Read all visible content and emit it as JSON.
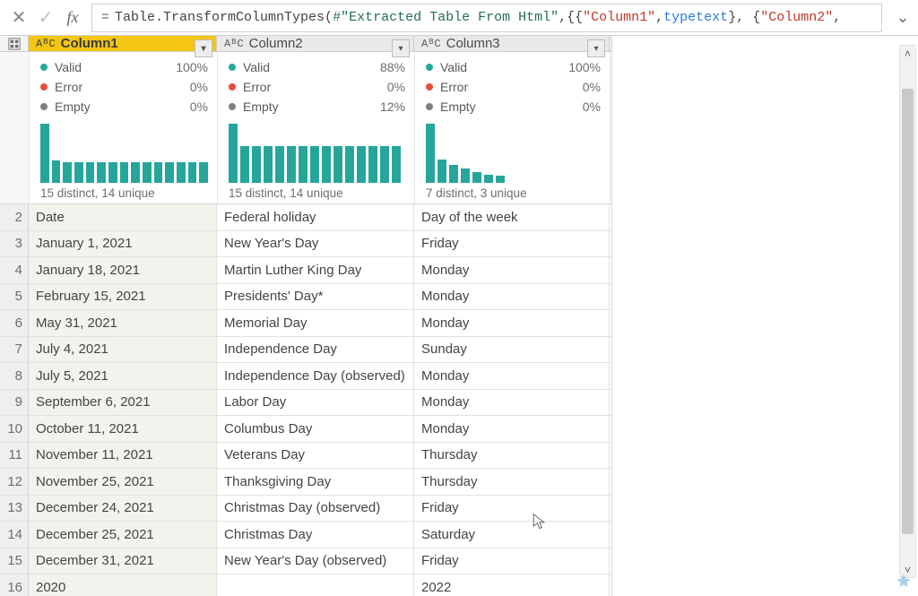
{
  "formula": {
    "equals": "=",
    "prefix": "Table.TransformColumnTypes(",
    "step_ref": "#\"Extracted Table From Html\"",
    "mid": ",{{",
    "str1": "\"Column1\"",
    "mid2": ", ",
    "kw_type1": "type",
    "sp1": " ",
    "kw_text1": "text",
    "mid3": "}, {",
    "str2": "\"Column2\"",
    "mid4": ","
  },
  "columns": [
    {
      "name": "Column1",
      "type_badge": "AᴮC",
      "selected": true,
      "quality": {
        "valid": "100%",
        "error": "0%",
        "empty": "0%",
        "empty_ratio": 0
      },
      "bars": [
        100,
        38,
        35,
        35,
        35,
        35,
        35,
        35,
        35,
        35,
        35,
        35,
        35,
        35,
        35
      ],
      "distinct_text": "15 distinct, 14 unique"
    },
    {
      "name": "Column2",
      "type_badge": "AᴮC",
      "selected": false,
      "quality": {
        "valid": "88%",
        "error": "0%",
        "empty": "12%",
        "empty_ratio": 0.12
      },
      "bars": [
        100,
        62,
        62,
        62,
        62,
        62,
        62,
        62,
        62,
        62,
        62,
        62,
        62,
        62,
        62
      ],
      "distinct_text": "15 distinct, 14 unique"
    },
    {
      "name": "Column3",
      "type_badge": "AᴮC",
      "selected": false,
      "quality": {
        "valid": "100%",
        "error": "0%",
        "empty": "0%",
        "empty_ratio": 0
      },
      "bars": [
        100,
        40,
        30,
        24,
        18,
        14,
        12
      ],
      "distinct_text": "7 distinct, 3 unique"
    }
  ],
  "metric_labels": {
    "valid": "Valid",
    "error": "Error",
    "empty": "Empty"
  },
  "rows": [
    {
      "n": 2,
      "c1": "Date",
      "c2": "Federal holiday",
      "c3": "Day of the week"
    },
    {
      "n": 3,
      "c1": "January 1, 2021",
      "c2": "New Year's Day",
      "c3": "Friday"
    },
    {
      "n": 4,
      "c1": "January 18, 2021",
      "c2": "Martin Luther King Day",
      "c3": "Monday"
    },
    {
      "n": 5,
      "c1": "February 15, 2021",
      "c2": "Presidents' Day*",
      "c3": "Monday"
    },
    {
      "n": 6,
      "c1": "May 31, 2021",
      "c2": "Memorial Day",
      "c3": "Monday"
    },
    {
      "n": 7,
      "c1": "July 4, 2021",
      "c2": "Independence Day",
      "c3": "Sunday"
    },
    {
      "n": 8,
      "c1": "July 5, 2021",
      "c2": "Independence Day (observed)",
      "c3": "Monday"
    },
    {
      "n": 9,
      "c1": "September 6, 2021",
      "c2": "Labor Day",
      "c3": "Monday"
    },
    {
      "n": 10,
      "c1": "October 11, 2021",
      "c2": "Columbus Day",
      "c3": "Monday"
    },
    {
      "n": 11,
      "c1": "November 11, 2021",
      "c2": "Veterans Day",
      "c3": "Thursday"
    },
    {
      "n": 12,
      "c1": "November 25, 2021",
      "c2": "Thanksgiving Day",
      "c3": "Thursday"
    },
    {
      "n": 13,
      "c1": "December 24, 2021",
      "c2": "Christmas Day (observed)",
      "c3": "Friday"
    },
    {
      "n": 14,
      "c1": "December 25, 2021",
      "c2": "Christmas Day",
      "c3": "Saturday"
    },
    {
      "n": 15,
      "c1": "December 31, 2021",
      "c2": "New Year's Day (observed)",
      "c3": "Friday"
    },
    {
      "n": 16,
      "c1": "2020",
      "c2": "",
      "c3": "2022"
    }
  ],
  "chart_data": [
    {
      "type": "bar",
      "title": "Column1 value distribution",
      "categories_note": "15 distinct, 14 unique",
      "values": [
        100,
        38,
        35,
        35,
        35,
        35,
        35,
        35,
        35,
        35,
        35,
        35,
        35,
        35,
        35
      ]
    },
    {
      "type": "bar",
      "title": "Column2 value distribution",
      "categories_note": "15 distinct, 14 unique",
      "values": [
        100,
        62,
        62,
        62,
        62,
        62,
        62,
        62,
        62,
        62,
        62,
        62,
        62,
        62,
        62
      ]
    },
    {
      "type": "bar",
      "title": "Column3 value distribution",
      "categories_note": "7 distinct, 3 unique",
      "values": [
        100,
        40,
        30,
        24,
        18,
        14,
        12
      ]
    }
  ]
}
